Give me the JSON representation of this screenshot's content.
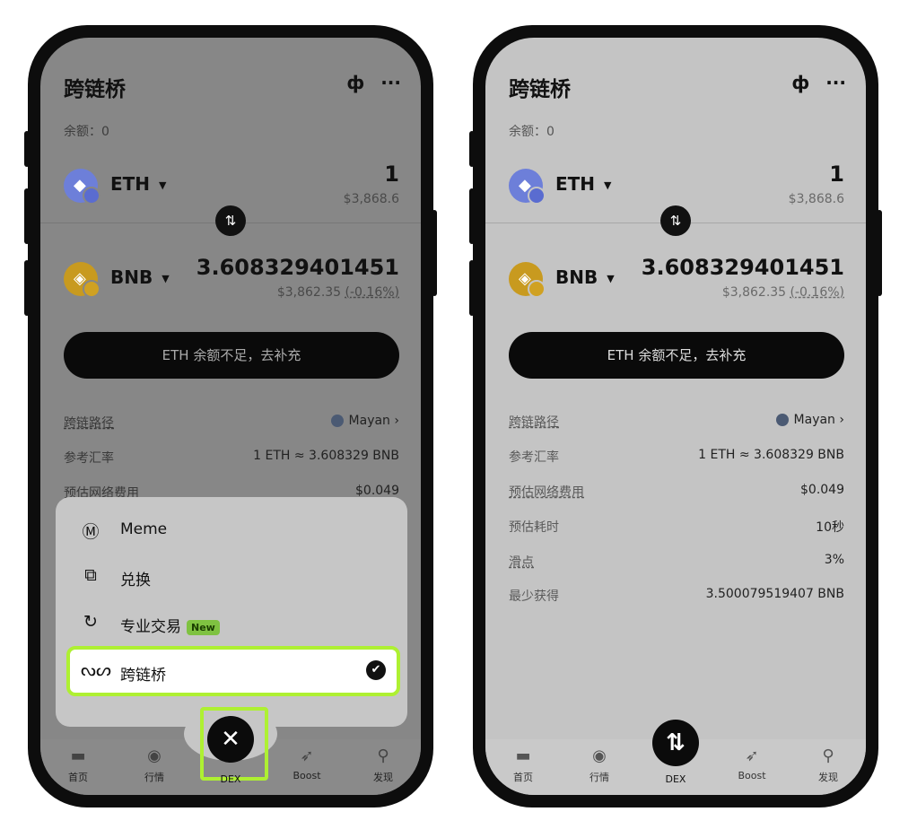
{
  "left": {
    "title": "跨链桥",
    "balance": "余额：0",
    "from": {
      "symbol": "ETH",
      "amount": "1",
      "fiat": "$3,868.6"
    },
    "to": {
      "symbol": "BNB",
      "amount": "3.608329401451",
      "fiat": "$3,862.35",
      "change": "(-0.16%)"
    },
    "cta": "ETH 余额不足，去补充",
    "details": [
      {
        "label": "跨链路径",
        "value": "Mayan"
      },
      {
        "label": "参考汇率",
        "value": "1 ETH ≈ 3.608329 BNB"
      },
      {
        "label": "预估网络费用",
        "value": "$0.049"
      }
    ],
    "menu": [
      {
        "label": "Meme"
      },
      {
        "label": "兑换"
      },
      {
        "label": "专业交易",
        "badge": "New"
      },
      {
        "label": "跨链桥"
      }
    ],
    "tabs": [
      "首页",
      "行情",
      "DEX",
      "Boost",
      "发现"
    ]
  },
  "right": {
    "title": "跨链桥",
    "balance": "余额：0",
    "from": {
      "symbol": "ETH",
      "amount": "1",
      "fiat": "$3,868.6"
    },
    "to": {
      "symbol": "BNB",
      "amount": "3.608329401451",
      "fiat": "$3,862.35",
      "change": "(-0.16%)"
    },
    "cta": "ETH 余额不足，去补充",
    "details": [
      {
        "label": "跨链路径",
        "value": "Mayan"
      },
      {
        "label": "参考汇率",
        "value": "1 ETH ≈ 3.608329 BNB"
      },
      {
        "label": "预估网络费用",
        "value": "$0.049"
      },
      {
        "label": "预估耗时",
        "value": "10秒"
      },
      {
        "label": "滑点",
        "value": "3%"
      },
      {
        "label": "最少获得",
        "value": "3.500079519407 BNB"
      }
    ],
    "tabs": [
      "首页",
      "行情",
      "DEX",
      "Boost",
      "发现"
    ]
  },
  "accent": "#aef032"
}
